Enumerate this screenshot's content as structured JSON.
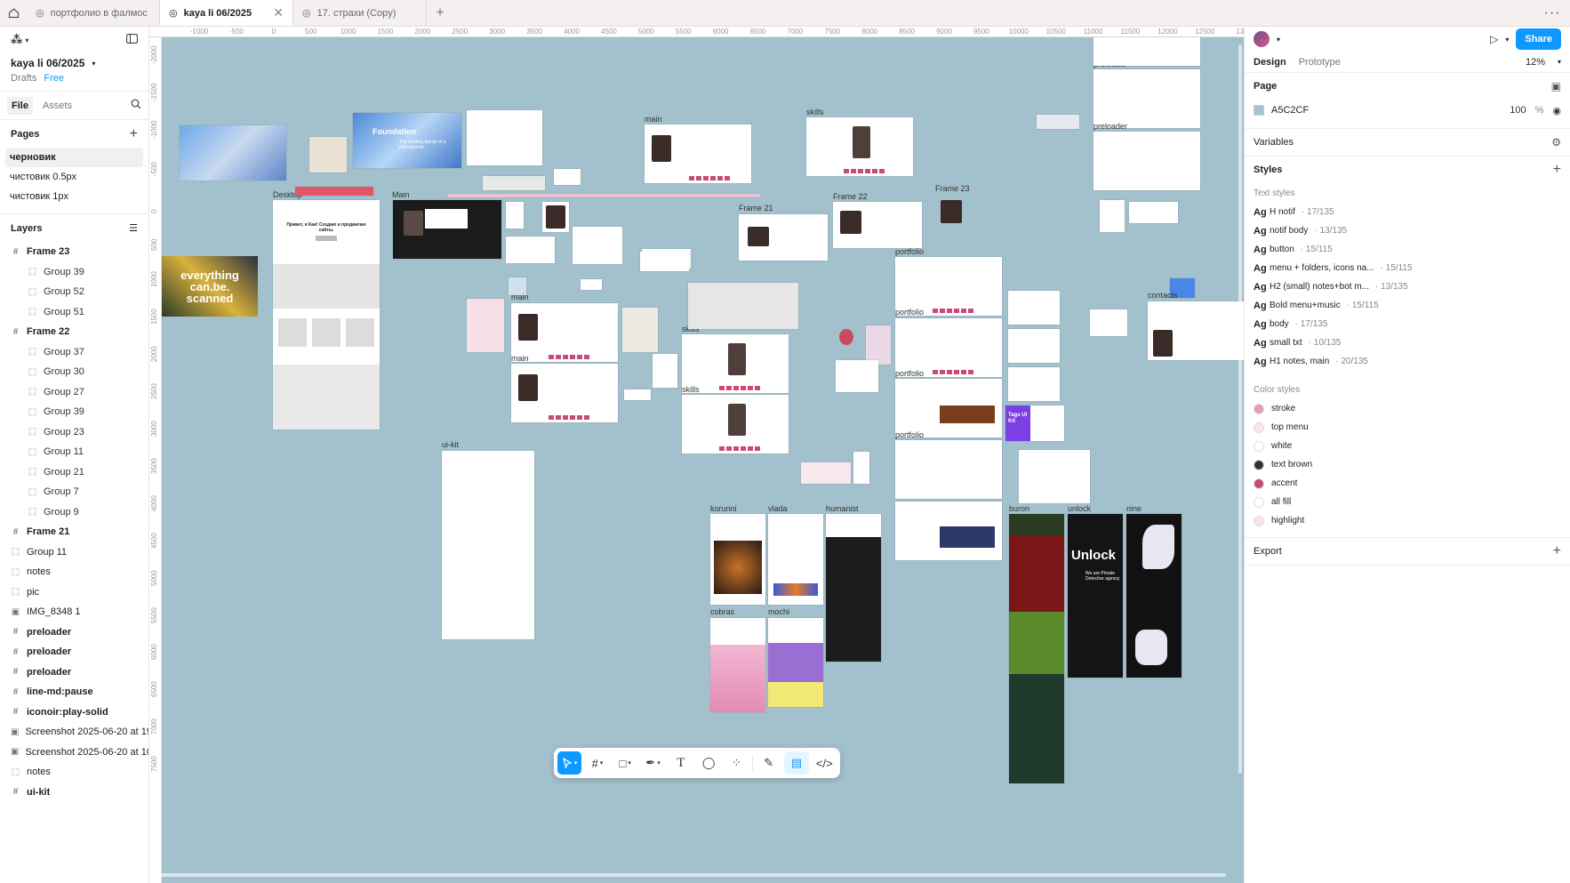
{
  "tabs": [
    {
      "label": "портфолио в фалмос",
      "active": false
    },
    {
      "label": "kaya li 06/2025",
      "active": true
    },
    {
      "label": "17. страхи (Copy)",
      "active": false
    }
  ],
  "file": {
    "title": "kaya li 06/2025",
    "location": "Drafts",
    "plan": "Free"
  },
  "left_tabs": {
    "file": "File",
    "assets": "Assets"
  },
  "pages": {
    "title": "Pages",
    "items": [
      "черновик",
      "чистовик 0.5px",
      "чистовик 1px"
    ]
  },
  "layers": {
    "title": "Layers",
    "items": [
      {
        "label": "Frame 23",
        "kind": "frame"
      },
      {
        "label": "Group 39",
        "kind": "group"
      },
      {
        "label": "Group 52",
        "kind": "group"
      },
      {
        "label": "Group 51",
        "kind": "group"
      },
      {
        "label": "Frame 22",
        "kind": "frame"
      },
      {
        "label": "Group 37",
        "kind": "group"
      },
      {
        "label": "Group 30",
        "kind": "group"
      },
      {
        "label": "Group 27",
        "kind": "group"
      },
      {
        "label": "Group 39",
        "kind": "group"
      },
      {
        "label": "Group 23",
        "kind": "group"
      },
      {
        "label": "Group 11",
        "kind": "group"
      },
      {
        "label": "Group 21",
        "kind": "group"
      },
      {
        "label": "Group 7",
        "kind": "group"
      },
      {
        "label": "Group 9",
        "kind": "group"
      },
      {
        "label": "Frame 21",
        "kind": "frame"
      },
      {
        "label": "Group 11",
        "kind": "group-top"
      },
      {
        "label": "notes",
        "kind": "group-top"
      },
      {
        "label": "pic",
        "kind": "group-top"
      },
      {
        "label": "IMG_8348 1",
        "kind": "image"
      },
      {
        "label": "preloader",
        "kind": "frame"
      },
      {
        "label": "preloader",
        "kind": "frame"
      },
      {
        "label": "preloader",
        "kind": "frame"
      },
      {
        "label": "line-md:pause",
        "kind": "frame"
      },
      {
        "label": "iconoir:play-solid",
        "kind": "frame"
      },
      {
        "label": "Screenshot 2025-06-20 at 19.32.04 1",
        "kind": "image"
      },
      {
        "label": "Screenshot 2025-06-20 at 10.17.21 1",
        "kind": "image"
      },
      {
        "label": "notes",
        "kind": "group-top"
      },
      {
        "label": "ui-kit",
        "kind": "frame"
      }
    ]
  },
  "ruler": {
    "top": [
      "-1000",
      "-500",
      "0",
      "500",
      "1000",
      "1500",
      "2000",
      "2500",
      "3000",
      "3500",
      "4000",
      "4500",
      "5000",
      "5500",
      "6000",
      "6500",
      "7000",
      "7500",
      "8000",
      "8500",
      "9000",
      "9500",
      "10000",
      "10500",
      "11000",
      "11500",
      "12000",
      "12500",
      "130"
    ],
    "left": [
      "-2000",
      "-1500",
      "-1000",
      "-500",
      "0",
      "500",
      "1000",
      "1500",
      "2000",
      "2500",
      "3000",
      "3500",
      "4000",
      "4500",
      "5000",
      "5500",
      "6000",
      "6500",
      "7000",
      "7500"
    ]
  },
  "canvas": {
    "background": "#A3C0CD",
    "frame_labels": {
      "desktop": "Desktop",
      "main_a": "Main",
      "main_b": "main",
      "main_c": "main",
      "main_d": "main",
      "skills_a": "skills",
      "skills_b": "skills",
      "skills_c": "skills",
      "frame21": "Frame 21",
      "frame22": "Frame 22",
      "frame23": "Frame 23",
      "portfolio_a": "portfolio",
      "portfolio_b": "portfolio",
      "portfolio_c": "portfolio",
      "portfolio_d": "portfolio",
      "preloader_a": "preloader",
      "preloader_b": "preloader",
      "contacts": "contacts",
      "uikit": "ui-kit",
      "korunni": "korunni",
      "vlada": "vlada",
      "humanist": "humanist",
      "cobras": "cobras",
      "mochi": "mochi",
      "buron": "buron",
      "unlock": "unlock",
      "nine": "nine"
    },
    "texts": {
      "everything": "everything can.be. scanned",
      "foundation": "Foundation",
      "foundation_sub": "The building blocks of a new internet.",
      "unlock_title": "Unlock",
      "unlock_sub": "We are Private Detective agency",
      "desktop_heading": "Привет, я Кая! Создаю и продвигаю сайты.",
      "tags": "Tags UI Kit"
    }
  },
  "toolbar": {
    "tools": [
      "move-tool",
      "frame-tool",
      "shape-tool",
      "pen-tool",
      "text-tool",
      "comment-tool",
      "actions-tool"
    ],
    "extra": [
      "draw-mode",
      "design-mode",
      "dev-mode"
    ]
  },
  "help_label": "?",
  "right_panel": {
    "share": "Share",
    "tabs": {
      "design": "Design",
      "prototype": "Prototype"
    },
    "zoom": "12%",
    "page": {
      "title": "Page",
      "fill_hex": "A5C2CF",
      "opacity": "100",
      "unit": "%"
    },
    "variables": "Variables",
    "styles": "Styles",
    "text_styles_title": "Text styles",
    "text_styles": [
      {
        "ag": "Ag",
        "name": "H notif",
        "meta": "· 17/135"
      },
      {
        "ag": "Ag",
        "name": "notif body",
        "meta": "· 13/135"
      },
      {
        "ag": "Ag",
        "name": "button",
        "meta": "· 15/115"
      },
      {
        "ag": "Ag",
        "name": "menu + folders, icons na...",
        "meta": "· 15/115"
      },
      {
        "ag": "Ag",
        "name": "H2 (small) notes+bot m...",
        "meta": "· 13/135"
      },
      {
        "ag": "Ag",
        "name": "Bold menu+music",
        "meta": "· 15/115"
      },
      {
        "ag": "Ag",
        "name": "body",
        "meta": "· 17/135"
      },
      {
        "ag": "Ag",
        "name": "small txt",
        "meta": "· 10/135"
      },
      {
        "ag": "Ag",
        "name": "H1 notes, main",
        "meta": "· 20/135"
      }
    ],
    "color_styles_title": "Color styles",
    "color_styles": [
      {
        "name": "stroke",
        "color": "#E89AB4"
      },
      {
        "name": "top menu",
        "color": "#F9E6EE"
      },
      {
        "name": "white",
        "color": "#FFFFFF"
      },
      {
        "name": "text brown",
        "color": "#3B2E2E"
      },
      {
        "name": "accent",
        "color": "#C94A75"
      },
      {
        "name": "all fill",
        "color": "#FFFFFF"
      },
      {
        "name": "highlight",
        "color": "#FBE3EC"
      }
    ],
    "export": "Export"
  },
  "accent_color": "#0D99FF"
}
